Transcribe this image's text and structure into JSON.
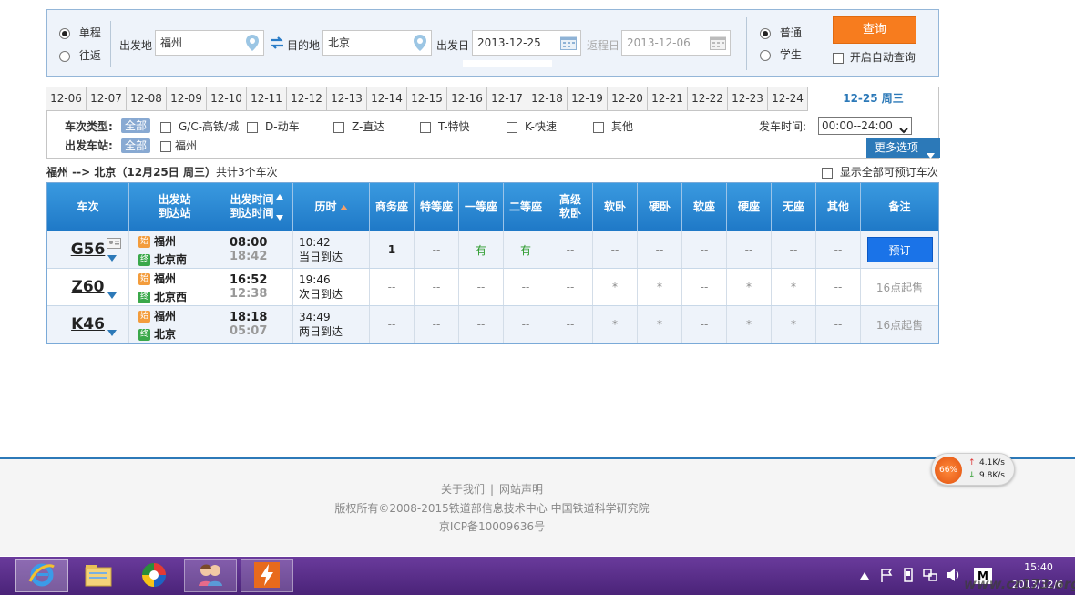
{
  "search": {
    "trip_oneway": "单程",
    "trip_round": "往返",
    "from_label": "出发地",
    "from_value": "福州",
    "to_label": "目的地",
    "to_value": "北京",
    "depart_label": "出发日",
    "depart_value": "2013-12-25",
    "return_label": "返程日",
    "return_value": "2013-12-06",
    "type_normal": "普通",
    "type_student": "学生",
    "query_button": "查询",
    "auto_query": "开启自动查询"
  },
  "dates": [
    "12-06",
    "12-07",
    "12-08",
    "12-09",
    "12-10",
    "12-11",
    "12-12",
    "12-13",
    "12-14",
    "12-15",
    "12-16",
    "12-17",
    "12-18",
    "12-19",
    "12-20",
    "12-21",
    "12-22",
    "12-23",
    "12-24"
  ],
  "selected_date": "12-25 周三",
  "filter": {
    "train_type_label": "车次类型:",
    "all": "全部",
    "types": [
      "G/C-高铁/城",
      "D-动车",
      "Z-直达",
      "T-特快",
      "K-快速",
      "其他"
    ],
    "station_label": "出发车站:",
    "station_all": "全部",
    "station": "福州",
    "depart_time_label": "发车时间:",
    "depart_time_value": "00:00--24:00",
    "more_options": "更多选项"
  },
  "summary": {
    "route": "福州 --> 北京（12月25日 周三）",
    "count": "共计3个车次",
    "show_all": "显示全部可预订车次"
  },
  "table": {
    "headers": {
      "train": "车次",
      "station_1": "出发站",
      "station_2": "到达站",
      "time_1": "出发时间",
      "time_2": "到达时间",
      "duration": "历时",
      "business": "商务座",
      "premium": "特等座",
      "first": "一等座",
      "second": "二等座",
      "soft_sleeper_top": "高级",
      "soft_sleeper_bottom": "软卧",
      "soft_sleeper": "软卧",
      "hard_sleeper": "硬卧",
      "soft_seat": "软座",
      "hard_seat": "硬座",
      "no_seat": "无座",
      "other": "其他",
      "remark": "备注"
    },
    "rows": [
      {
        "no": "G56",
        "from": "福州",
        "to": "北京南",
        "dep": "08:00",
        "arr": "18:42",
        "dur": "10:42",
        "dur_note": "当日到达",
        "cells": [
          "1",
          "--",
          "有",
          "有",
          "--",
          "--",
          "--",
          "--",
          "--",
          "--",
          "--"
        ],
        "remark": "预订"
      },
      {
        "no": "Z60",
        "from": "福州",
        "to": "北京西",
        "dep": "16:52",
        "arr": "12:38",
        "dur": "19:46",
        "dur_note": "次日到达",
        "cells": [
          "--",
          "--",
          "--",
          "--",
          "--",
          "*",
          "*",
          "--",
          "*",
          "*",
          "--"
        ],
        "remark": "16点起售"
      },
      {
        "no": "K46",
        "from": "福州",
        "to": "北京",
        "dep": "18:18",
        "arr": "05:07",
        "dur": "34:49",
        "dur_note": "两日到达",
        "cells": [
          "--",
          "--",
          "--",
          "--",
          "--",
          "*",
          "*",
          "--",
          "*",
          "*",
          "--"
        ],
        "remark": "16点起售"
      }
    ],
    "start_icon": "始",
    "end_icon": "终"
  },
  "footer": {
    "about": "关于我们",
    "statement": "网站声明",
    "copyright": "版权所有©2008-2015铁道部信息技术中心   中国铁道科学研究院",
    "icp": "京ICP备10009636号"
  },
  "netmeter": {
    "percent": "66%",
    "up": "4.1K/s",
    "down": "9.8K/s"
  },
  "taskbar": {
    "time": "15:40",
    "date": "2013/12/6",
    "ime": "M"
  },
  "watermark": "www.cr173.org"
}
